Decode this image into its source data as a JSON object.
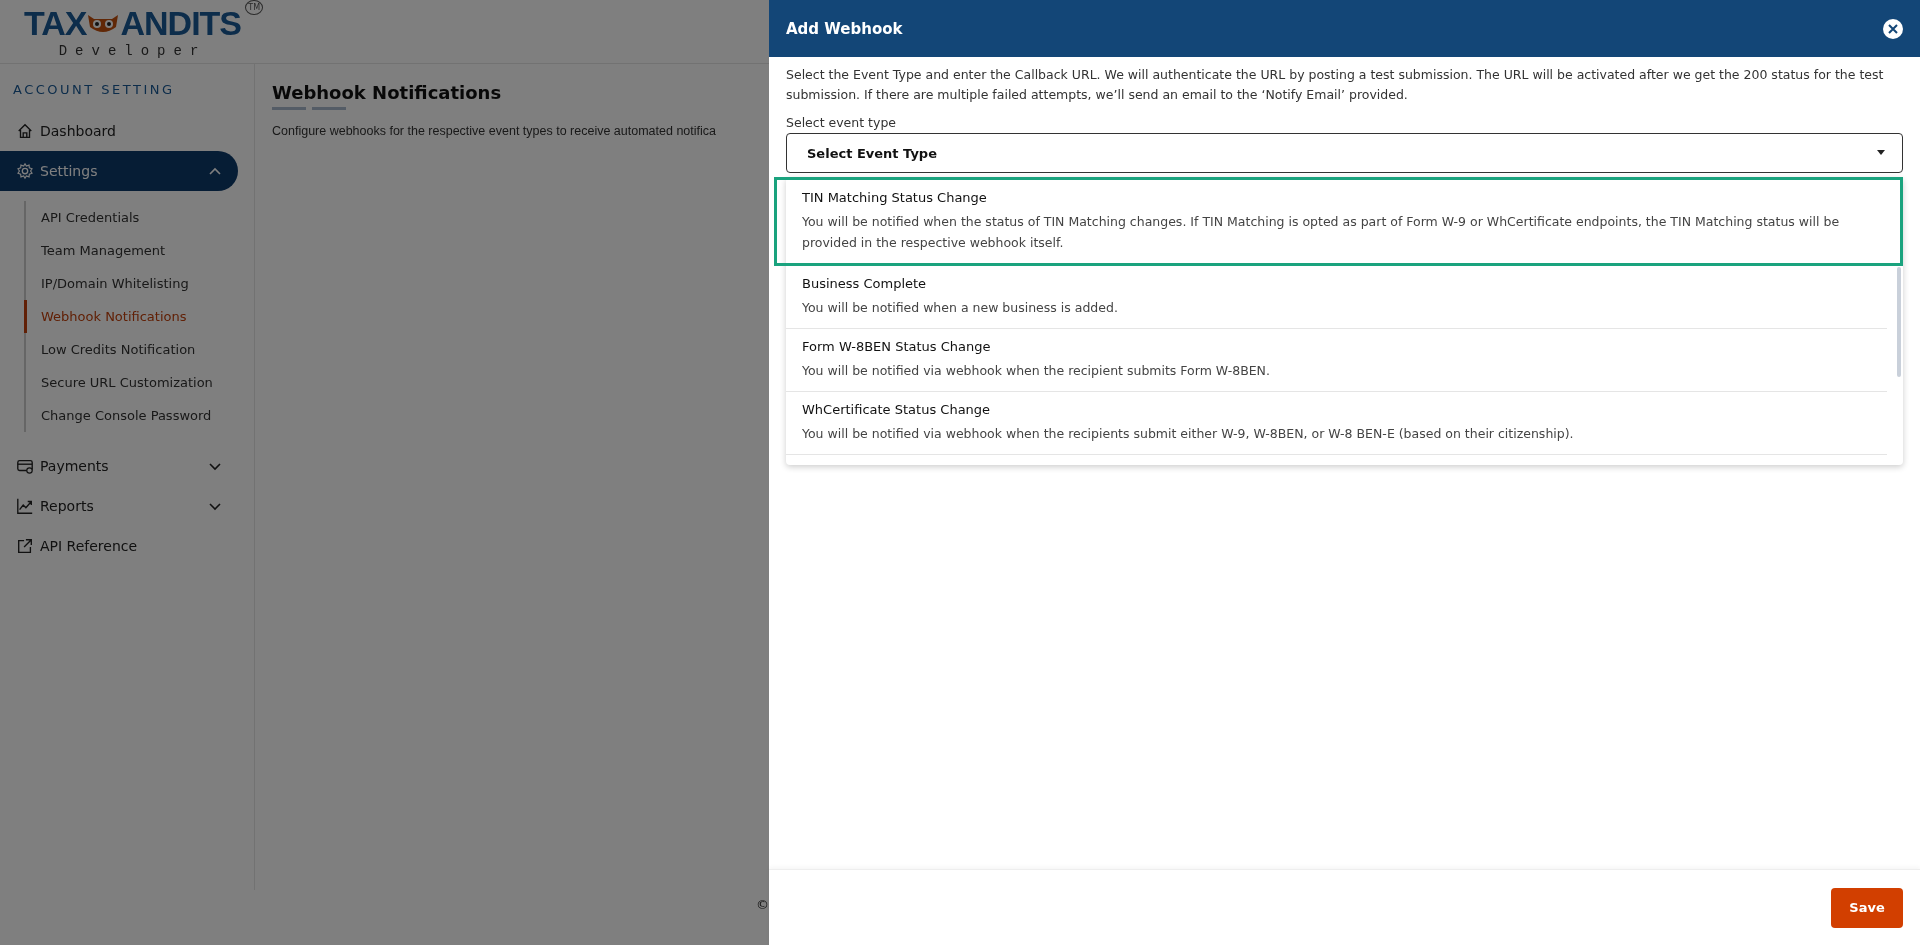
{
  "logo": {
    "left": "TAX",
    "right": "ANDITS",
    "trademark": "TM",
    "subtitle": "Developer"
  },
  "sidebar": {
    "section": "ACCOUNT SETTING",
    "items": [
      {
        "label": "Dashboard",
        "kind": "link"
      },
      {
        "label": "Settings",
        "kind": "group",
        "expanded": true,
        "selected": true,
        "children": [
          {
            "label": "API Credentials",
            "selected": false
          },
          {
            "label": "Team Management",
            "selected": false
          },
          {
            "label": "IP/Domain Whitelisting",
            "selected": false
          },
          {
            "label": "Webhook Notifications",
            "selected": true
          },
          {
            "label": "Low Credits Notification",
            "selected": false
          },
          {
            "label": "Secure URL Customization",
            "selected": false
          },
          {
            "label": "Change Console Password",
            "selected": false
          }
        ]
      },
      {
        "label": "Payments",
        "kind": "group",
        "expanded": false,
        "selected": false
      },
      {
        "label": "Reports",
        "kind": "group",
        "expanded": false,
        "selected": false
      },
      {
        "label": "API Reference",
        "kind": "link"
      }
    ]
  },
  "main": {
    "title": "Webhook Notifications",
    "description": "Configure webhooks for the respective event types to receive automated notifica"
  },
  "footer": {
    "text": "©"
  },
  "drawer": {
    "title": "Add Webhook",
    "intro": "Select the Event Type and enter the Callback URL. We will authenticate the URL by posting a test submission. The URL will be activated after we get the 200 status for the test submission. If there are multiple failed attempts, we’ll send an email to the ‘Notify Email’ provided.",
    "field_label": "Select event type",
    "select_value": "Select Event Type",
    "options": [
      {
        "title": "TIN Matching Status Change",
        "description": "You will be notified when the status of TIN Matching changes. If TIN Matching is opted as part of Form W-9 or WhCertificate endpoints, the TIN Matching status will be provided in the respective webhook itself.",
        "highlighted": true
      },
      {
        "title": "Business Complete",
        "description": "You will be notified when a new business is added.",
        "highlighted": false
      },
      {
        "title": "Form W-8BEN Status Change",
        "description": "You will be notified via webhook when the recipient submits Form W-8BEN.",
        "highlighted": false
      },
      {
        "title": "WhCertificate Status Change",
        "description": "You will be notified via webhook when the recipients submit either W-9, W-8BEN, or W-8 BEN-E (based on their citizenship).",
        "highlighted": false
      }
    ],
    "save_button": "Save"
  }
}
